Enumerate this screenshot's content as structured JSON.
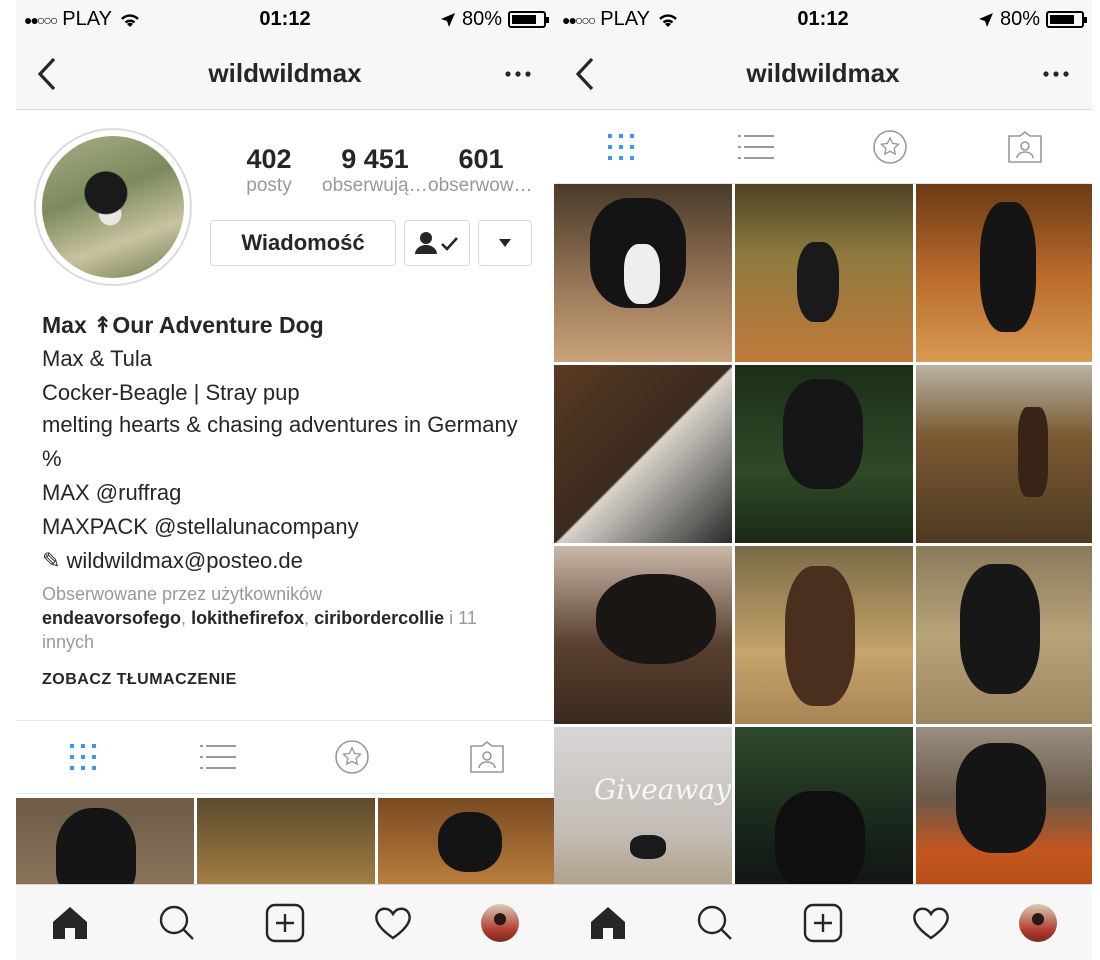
{
  "status_bar": {
    "signal_dots": "●●○○○",
    "carrier": "PLAY",
    "time": "01:12",
    "battery_percent": "80%",
    "battery_level": 0.8
  },
  "header": {
    "username": "wildwildmax"
  },
  "profile": {
    "stats": [
      {
        "value": "402",
        "label": "posty"
      },
      {
        "value": "9 451",
        "label": "obserwujących"
      },
      {
        "value": "601",
        "label": "obserwowanych"
      }
    ],
    "message_button": "Wiadomość",
    "bio": {
      "name": "Max ↟Our Adventure Dog",
      "lines": [
        "Max & Tula",
        "Cocker-Beagle | Stray pup",
        "melting hearts & chasing adventures in Germany",
        "%",
        "MAX @ruffrag",
        "MAXPACK @stellalunacompany",
        "✎ wildwildmax@posteo.de"
      ]
    },
    "followed_by_prefix": "Obserwowane przez użytkowników",
    "followed_by_users": [
      "endeavorsofego",
      "lokithefirefox",
      "ciribordercollie"
    ],
    "followed_by_suffix": " i 11 innych",
    "translate_link": "ZOBACZ TŁUMACZENIE"
  },
  "tabs": [
    {
      "icon": "grid-icon",
      "active": true
    },
    {
      "icon": "list-icon",
      "active": false
    },
    {
      "icon": "star-icon",
      "active": false
    },
    {
      "icon": "tagged-icon",
      "active": false
    }
  ],
  "right_overlay_text": "Giveaway",
  "colors": {
    "accent_blue": "#3897f0",
    "text": "#262626",
    "muted": "#999999"
  },
  "bottom_nav": [
    "home-icon",
    "search-icon",
    "add-post-icon",
    "heart-icon",
    "profile-avatar"
  ]
}
